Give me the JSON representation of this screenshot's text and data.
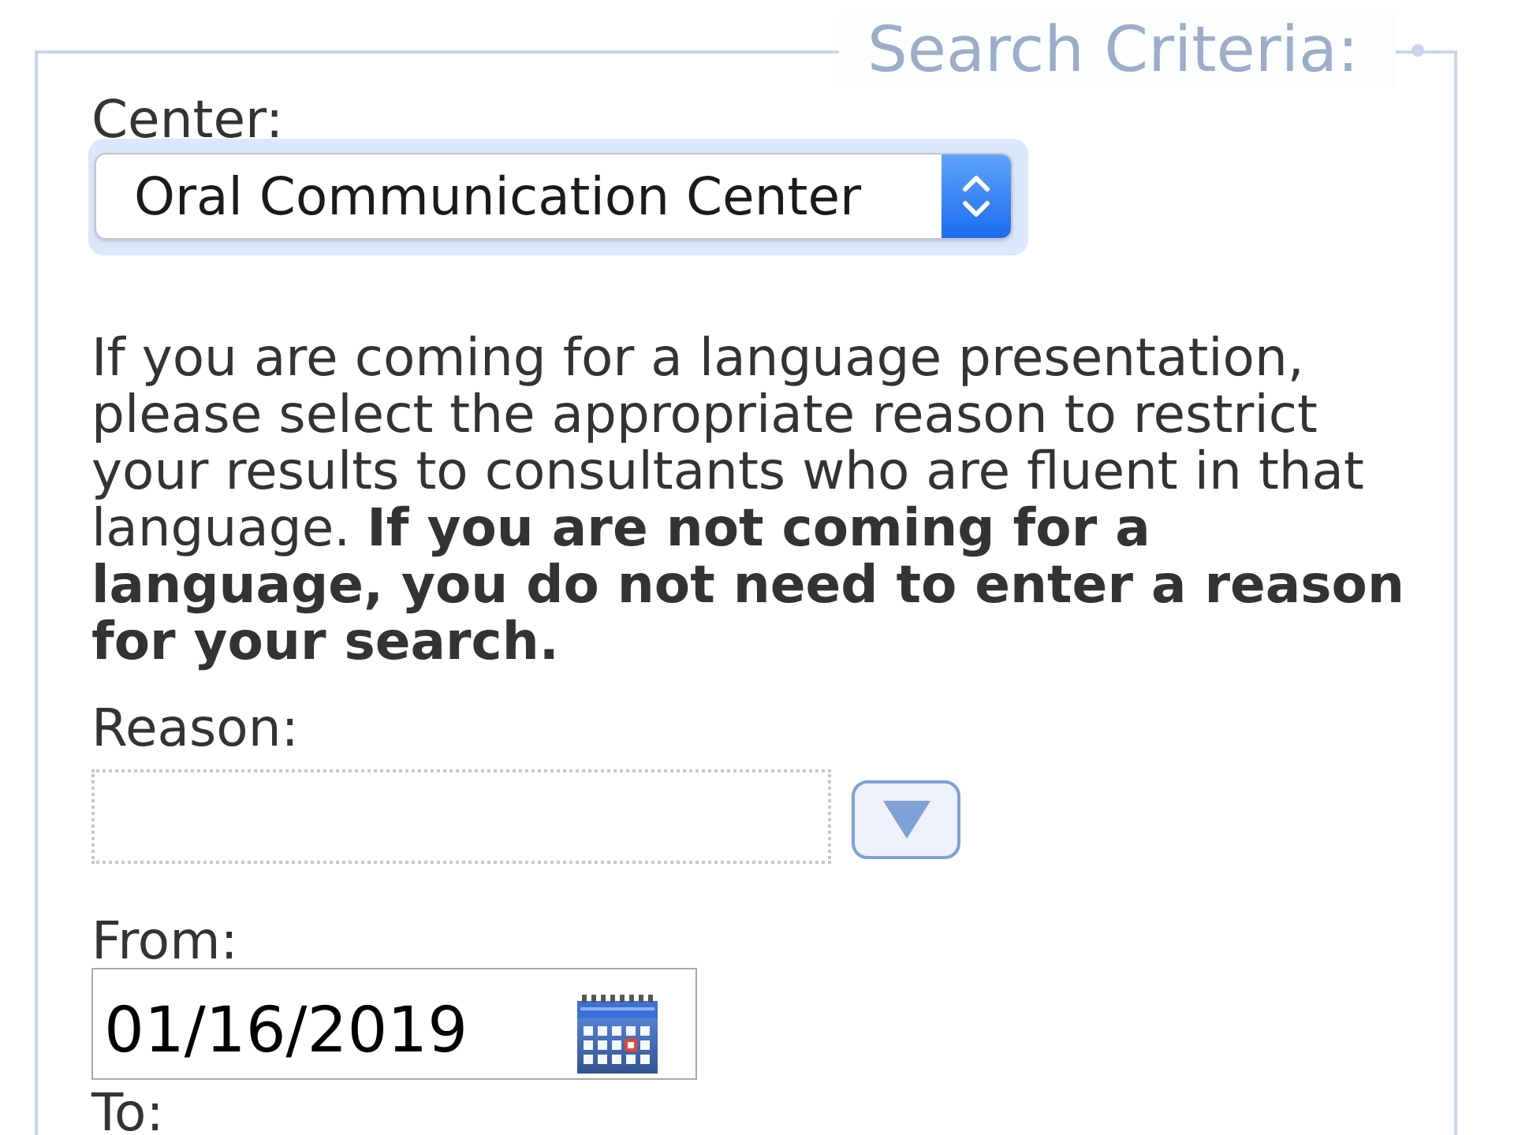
{
  "fieldset": {
    "legend": "Search Criteria:"
  },
  "center": {
    "label": "Center:",
    "value": "Oral Communication Center",
    "focused": true
  },
  "instructions": "If you are coming for a language presentation, please select the appropriate reason to restrict your results to consultants who are fluent in that language. **If you are not coming for a language, you do not need to enter a reason for your search.**",
  "reason": {
    "label": "Reason:"
  },
  "from": {
    "label": "From:",
    "value": "01/16/2019"
  },
  "to": {
    "label": "To:"
  }
}
